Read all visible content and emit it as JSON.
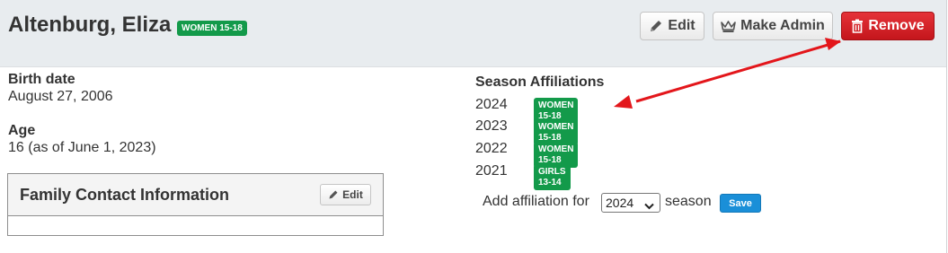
{
  "header": {
    "player_name": "Altenburg, Eliza",
    "player_badge": "WOMEN 15-18",
    "edit_label": "Edit",
    "make_admin_label": "Make Admin",
    "remove_label": "Remove"
  },
  "details": {
    "birth_date_label": "Birth date",
    "birth_date_value": "August 27, 2006",
    "age_label": "Age",
    "age_value": "16 (as of June 1, 2023)"
  },
  "family_panel": {
    "title": "Family Contact Information",
    "edit_label": "Edit"
  },
  "seasons": {
    "title": "Season Affiliations",
    "rows": [
      {
        "year": "2024",
        "badge": "WOMEN 15-18"
      },
      {
        "year": "2023",
        "badge": "WOMEN 15-18"
      },
      {
        "year": "2022",
        "badge": "WOMEN 15-18"
      },
      {
        "year": "2021",
        "badge": "GIRLS 13-14"
      }
    ],
    "add_prefix": "Add affiliation for",
    "selected_season": "2024",
    "add_suffix": "season",
    "save_label": "Save"
  },
  "colors": {
    "badge_green": "#139a4a",
    "remove_red": "#c4161c",
    "save_blue": "#1a8fd8",
    "annotation_arrow": "#e3161b"
  },
  "icons": {
    "edit": "pencil-icon",
    "admin": "crown-icon",
    "remove": "trash-icon",
    "select": "chevron-down-icon"
  }
}
